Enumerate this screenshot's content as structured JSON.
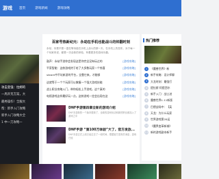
{
  "header": {
    "logo": "游戏",
    "nav": [
      "首页",
      "游戏新闻",
      "游戏攻略"
    ]
  },
  "left": {
    "lines": [
      "1.6",
      "攻击变强：拉姆的",
      "一周开荒方案，大",
      "最秀操作！全服大",
      "帮：新手入门攻略",
      "新手入门攻略大全",
      "1 中一刀攻略一"
    ],
    "highlight_index": 0
  },
  "main": {
    "headline": "百家号热新纪元：永劫在手机也能战斗的帅翻时刻",
    "summary": "永劫，你是不是一直在等待能在手机上战斗的那一天，在手机上的发布，对于每一个玩家来说，都是一次全新的体验，有着更多的游戏乐趣。",
    "news": [
      {
        "title": "鼓声：永劫手游你会发现这是你完全没有玩过的",
        "tag": "[游戏攻略]"
      },
      {
        "title": "平家智能：这款游戏终于给了大多数玩家一个惊喜",
        "tag": "[游戏攻略]"
      },
      {
        "title": "steam中不坑新游的平台，全靠它来，才能够",
        "tag": "[游戏攻略]"
      },
      {
        "title": "这就等于一个个玩家可以掌握一个强大游戏技能",
        "tag": "[游戏攻略]"
      },
      {
        "title": "战士职业攻略入门，带你轻松上手游戏，这个真的",
        "tag": "[游戏攻略]"
      },
      {
        "title": "电视游戏这样最好玩一点，这款游戏一定会出现在这",
        "tag": "[游戏攻略]"
      }
    ],
    "features": [
      {
        "title": "DNF手游第四章全新的游戏介绍",
        "desc": "DNF手游新的一个版本更新了，全新的游戏玩法和新的职业都加入了游戏之中"
      },
      {
        "title": "DNF手游 “第100万体验”大了，官方发放...",
        "desc": "DNF手游正式上线已经过去了一段时间，根据官方发布的消息，游戏已经"
      }
    ]
  },
  "right": {
    "title": "热门推荐",
    "items": [
      "《魔兽世界》新",
      "新手攻略：设计师聊",
      "大龙时刻：最强打",
      "提拉斯·阿提西尔",
      "新手入门：战士进",
      "魔兽世界1.11新版",
      "巴德战场中：【英",
      "天龙：为什么玩家",
      "世界游戏第20运",
      "《魔界变革新城》",
      "新的游戏副本新手"
    ]
  }
}
